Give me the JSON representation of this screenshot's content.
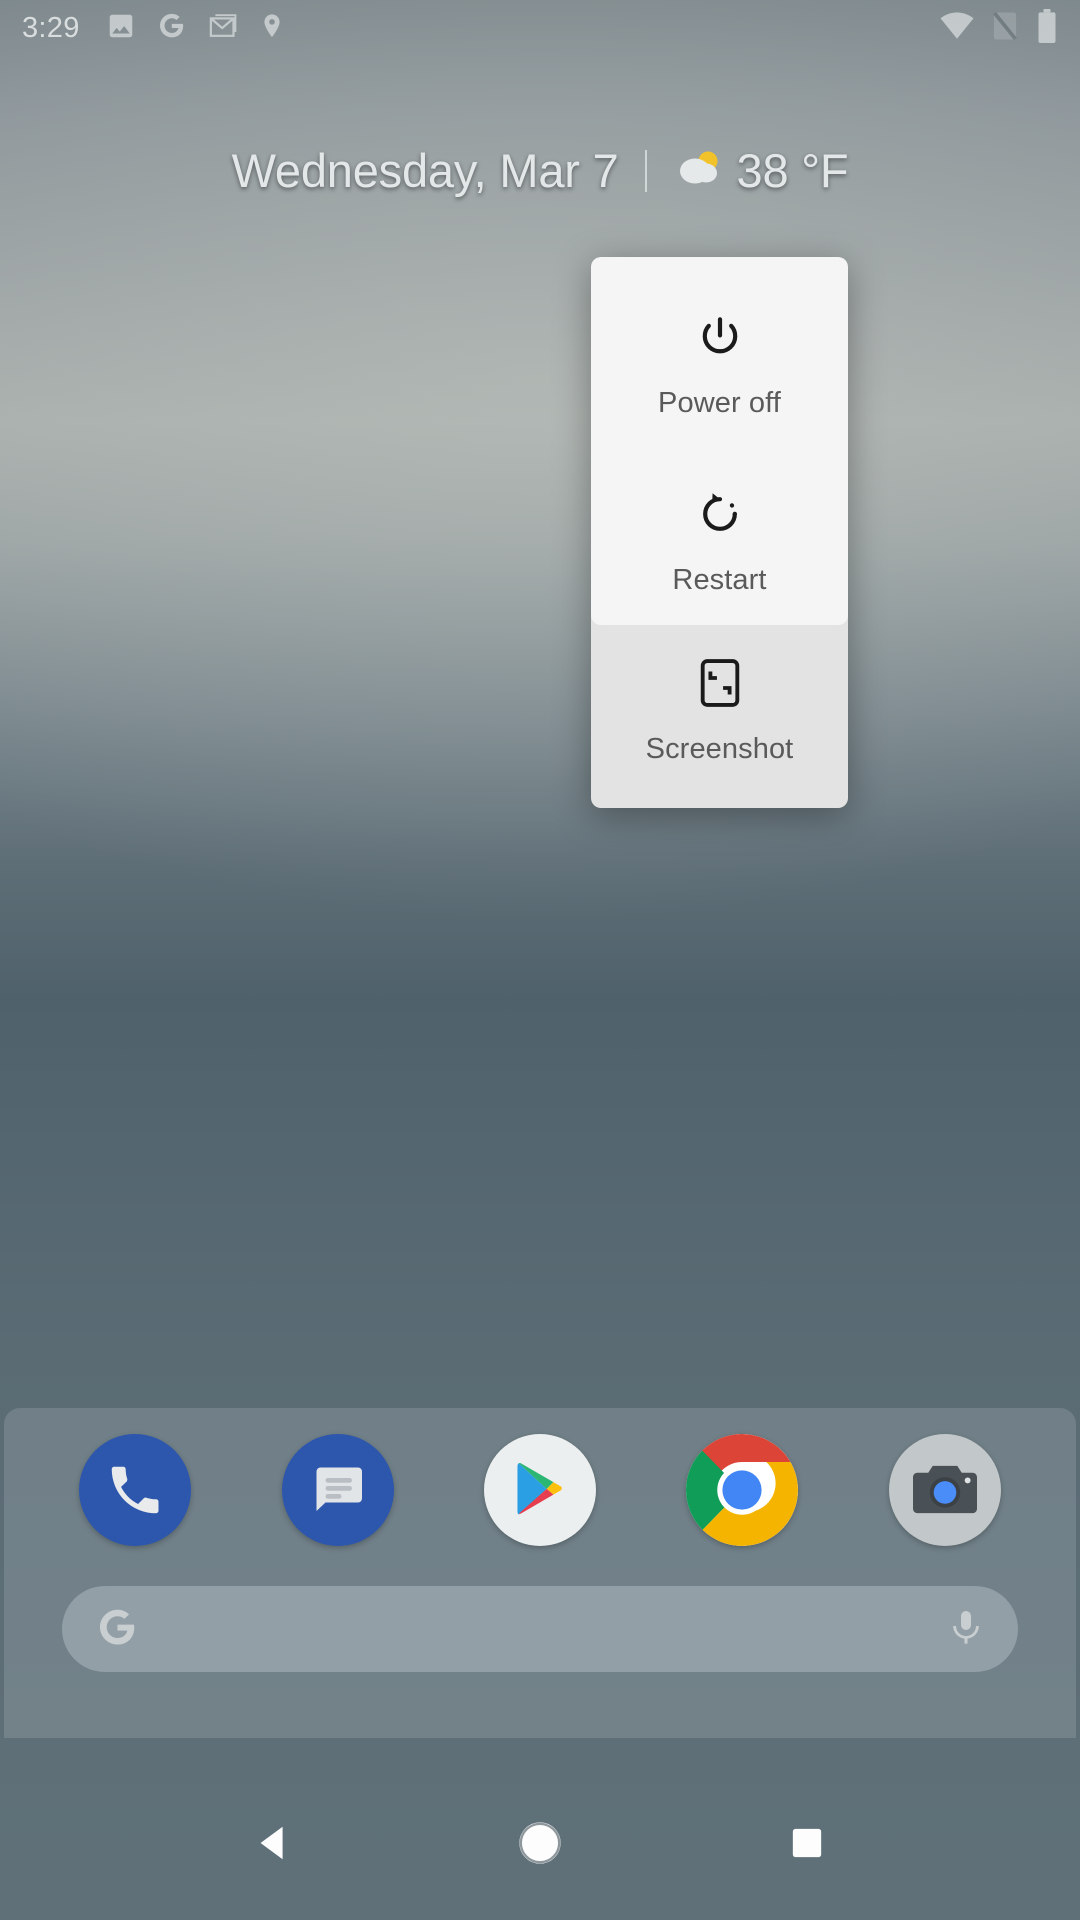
{
  "status_bar": {
    "time": "3:29",
    "left_icons": [
      "photos-icon",
      "google-icon",
      "gmail-icon",
      "location-icon"
    ],
    "right_icons": [
      "wifi-icon",
      "no-sim-icon",
      "battery-icon"
    ]
  },
  "widget": {
    "date": "Wednesday, Mar 7",
    "temperature": "38 °F",
    "weather_icon": "partly-cloudy-icon"
  },
  "power_menu": {
    "items": [
      {
        "id": "power-off",
        "label": "Power off",
        "icon": "power-icon"
      },
      {
        "id": "restart",
        "label": "Restart",
        "icon": "restart-icon"
      },
      {
        "id": "screenshot",
        "label": "Screenshot",
        "icon": "screenshot-icon"
      }
    ],
    "panel_top_color": "#f5f5f5",
    "panel_bottom_color": "#e3e3e3",
    "label_color": "#5a5a5a"
  },
  "dock": {
    "apps": [
      {
        "id": "phone",
        "name": "Phone",
        "icon": "phone-icon",
        "color": "#2d56ad"
      },
      {
        "id": "messages",
        "name": "Messages",
        "icon": "message-icon",
        "color": "#2d56ad"
      },
      {
        "id": "play-store",
        "name": "Play Store",
        "icon": "play-store-icon",
        "color": "#eceff0"
      },
      {
        "id": "chrome",
        "name": "Chrome",
        "icon": "chrome-icon",
        "color": "#f1f1f1"
      },
      {
        "id": "camera",
        "name": "Camera",
        "icon": "camera-icon",
        "color": "#c2c7c9"
      }
    ]
  },
  "search": {
    "placeholder": "",
    "value": "",
    "logo_icon": "google-g-icon",
    "mic_icon": "microphone-icon"
  },
  "nav_bar": {
    "back": "back-button",
    "home": "home-button",
    "recents": "recents-button"
  }
}
